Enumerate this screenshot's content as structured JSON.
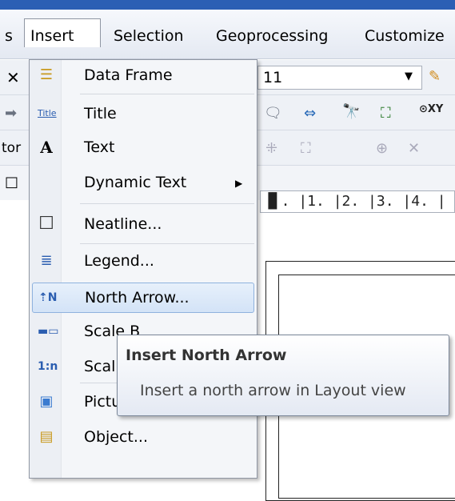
{
  "menubar": {
    "items": [
      "s",
      "Insert",
      "Selection",
      "Geoprocessing",
      "Customize"
    ]
  },
  "toolbar": {
    "scale_value": "11"
  },
  "ruler": {
    "text": "▐▌. |1. |2. |3. |4. |"
  },
  "insert_menu": {
    "items": [
      {
        "label": "Data Frame",
        "icon": "data-frame-icon"
      },
      {
        "label": "Title",
        "icon": "title-icon"
      },
      {
        "label": "Text",
        "icon": "text-icon"
      },
      {
        "label": "Dynamic Text",
        "icon": "dynamic-text-icon"
      },
      {
        "label": "Neatline...",
        "icon": "neatline-icon"
      },
      {
        "label": "Legend...",
        "icon": "legend-icon"
      },
      {
        "label": "North Arrow...",
        "icon": "north-arrow-icon"
      },
      {
        "label": "Scale B",
        "icon": "scale-bar-icon"
      },
      {
        "label": "Scal",
        "icon": "scale-text-icon"
      },
      {
        "label": "Pictu",
        "icon": "picture-icon"
      },
      {
        "label": "Object...",
        "icon": "object-icon"
      }
    ],
    "highlighted": "North Arrow..."
  },
  "tooltip": {
    "title": "Insert North Arrow",
    "body": "Insert a north arrow in Layout view"
  },
  "colors": {
    "title_strip": "#2b5fb4",
    "highlight": "#d3e3f7"
  }
}
